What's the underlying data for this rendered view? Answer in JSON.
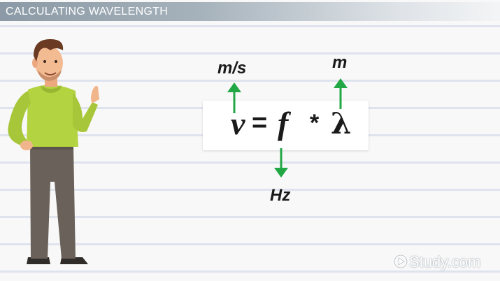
{
  "title": "CALCULATING WAVELENGTH",
  "formula": {
    "velocity_symbol": "v",
    "equals": "=",
    "frequency_symbol": "f",
    "multiply": "*",
    "wavelength_symbol": "λ"
  },
  "units": {
    "velocity": "m/s",
    "wavelength": "m",
    "frequency": "Hz"
  },
  "logo": {
    "text": "Study.com",
    "icon": "play-circle-icon"
  },
  "colors": {
    "arrow": "#22a745",
    "title_bar": "#95a3ae",
    "shirt": "#b4d340",
    "pants": "#6a625a"
  }
}
